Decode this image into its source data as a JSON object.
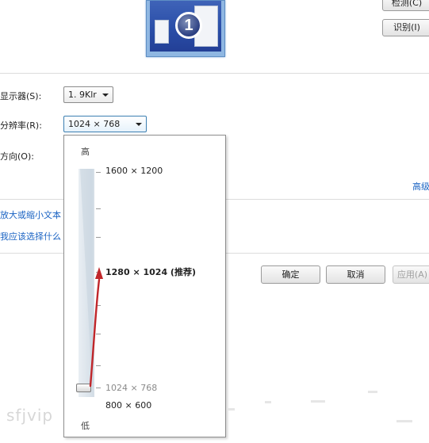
{
  "buttons": {
    "detect": "检测(C)",
    "identify": "识别(I)",
    "ok": "确定",
    "cancel": "取消",
    "apply": "应用(A)"
  },
  "monitor": {
    "number": "1"
  },
  "form": {
    "display_label": "显示器(S):",
    "display_value": "1. 9Klr",
    "resolution_label": "分辨率(R):",
    "resolution_value": "1024 × 768",
    "orientation_label": "方向(O):"
  },
  "links": {
    "advanced": "高级",
    "enlarge_text": "放大或缩小文本",
    "which_settings": "我应该选择什么"
  },
  "dropdown": {
    "high_label": "高",
    "low_label": "低",
    "options": [
      {
        "label": "1600 × 1200"
      },
      {
        "label": "1280 × 1024 (推荐)"
      },
      {
        "label": "1024 × 768"
      },
      {
        "label": "800 × 600"
      }
    ],
    "current_value": "1024 × 768",
    "recommended_value": "1280 × 1024 (推荐)"
  },
  "watermark": "sfjvip",
  "colors": {
    "link": "#1a63c3",
    "arrow": "#c0262a",
    "focus": "#3c7fb1"
  }
}
